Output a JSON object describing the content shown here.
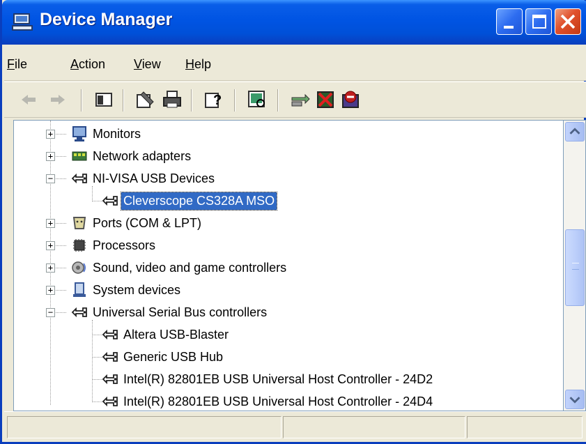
{
  "window": {
    "title": "Device Manager",
    "title_icon": "computer-icon"
  },
  "menu": [
    "File",
    "Action",
    "View",
    "Help"
  ],
  "toolbar": {
    "icons": [
      "back-arrow-icon",
      "forward-arrow-icon",
      "show-hide-console-tree-icon",
      "properties-icon",
      "print-icon",
      "help-icon",
      "scan-hardware-icon",
      "update-driver-icon",
      "uninstall-icon",
      "disable-icon"
    ]
  },
  "tree": {
    "items": [
      {
        "label": "Monitors",
        "level": 1,
        "expander": "+",
        "icon": "monitor-icon"
      },
      {
        "label": "Network adapters",
        "level": 1,
        "expander": "+",
        "icon": "network-adapter-icon"
      },
      {
        "label": "NI-VISA USB Devices",
        "level": 1,
        "expander": "−",
        "icon": "usb-icon"
      },
      {
        "label": "Cleverscope CS328A MSO",
        "level": 2,
        "expander": "",
        "icon": "usb-icon",
        "selected": true
      },
      {
        "label": "Ports (COM & LPT)",
        "level": 1,
        "expander": "+",
        "icon": "port-icon"
      },
      {
        "label": "Processors",
        "level": 1,
        "expander": "+",
        "icon": "processor-icon"
      },
      {
        "label": "Sound, video and game controllers",
        "level": 1,
        "expander": "+",
        "icon": "sound-icon"
      },
      {
        "label": "System devices",
        "level": 1,
        "expander": "+",
        "icon": "system-device-icon"
      },
      {
        "label": "Universal Serial Bus controllers",
        "level": 1,
        "expander": "−",
        "icon": "usb-icon"
      },
      {
        "label": "Altera USB-Blaster",
        "level": 2,
        "expander": "",
        "icon": "usb-icon"
      },
      {
        "label": "Generic USB Hub",
        "level": 2,
        "expander": "",
        "icon": "usb-icon"
      },
      {
        "label": "Intel(R) 82801EB USB Universal Host Controller - 24D2",
        "level": 2,
        "expander": "",
        "icon": "usb-icon"
      },
      {
        "label": "Intel(R) 82801EB USB Universal Host Controller - 24D4",
        "level": 2,
        "expander": "",
        "icon": "usb-icon"
      }
    ]
  },
  "colors": {
    "titlebar": "#0054e3",
    "selection": "#316ac5",
    "chrome": "#ece9d8"
  }
}
